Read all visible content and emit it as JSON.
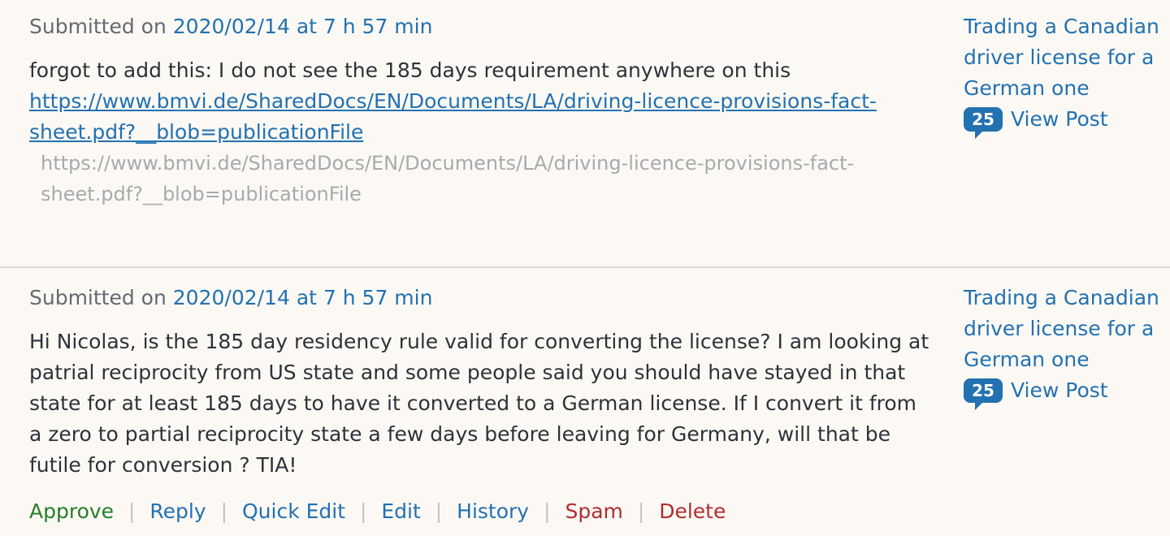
{
  "colors": {
    "background": "#fcf9f5",
    "link": "#2271b1",
    "muted": "#646970",
    "approve": "#287d28",
    "danger": "#b32d2e"
  },
  "comments": [
    {
      "submitted_prefix": "Submitted on",
      "submitted_date": "2020/02/14 at 7 h 57 min",
      "text": "forgot to add this: I do not see the 185 days requirement anywhere on this",
      "link": "https://www.bmvi.de/SharedDocs/EN/Documents/LA/driving-licence-provisions-fact-sheet.pdf?__blob=publicationFile",
      "preview": "https://www.bmvi.de/SharedDocs/EN/Documents/LA/driving-licence-provisions-fact-sheet.pdf?__blob=publicationFile",
      "post_title": "Trading a Canadian driver license for a German one",
      "count": "25",
      "view_post": "View Post"
    },
    {
      "submitted_prefix": "Submitted on",
      "submitted_date": "2020/02/14 at 7 h 57 min",
      "text": "Hi Nicolas, is the 185 day residency rule valid for converting the license? I am looking at patrial reciprocity from US state and some people said you should have stayed in that state for at least 185 days to have it converted to a German license. If I convert it from a zero to partial reciprocity state a few days before leaving for Germany, will that be futile for conversion ? TIA!",
      "post_title": "Trading a Canadian driver license for a German one",
      "count": "25",
      "view_post": "View Post",
      "actions": {
        "approve": "Approve",
        "reply": "Reply",
        "quick_edit": "Quick Edit",
        "edit": "Edit",
        "history": "History",
        "spam": "Spam",
        "delete": "Delete",
        "separator": "|"
      }
    }
  ]
}
